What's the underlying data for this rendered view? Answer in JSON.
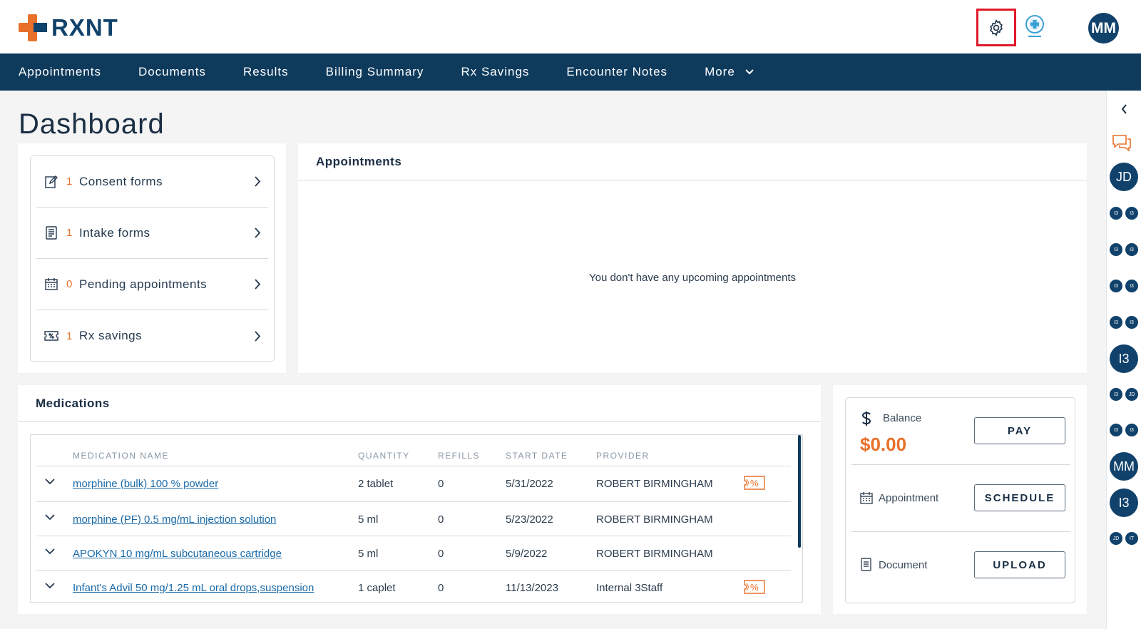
{
  "app": {
    "logo_text": "RXNT",
    "brand_colors": {
      "primary": "#0e3a5c",
      "accent": "#e8702a",
      "highlight": "#e0192a"
    },
    "user_initials": "MM"
  },
  "nav": {
    "items": [
      {
        "label": "Appointments"
      },
      {
        "label": "Documents"
      },
      {
        "label": "Results"
      },
      {
        "label": "Billing Summary"
      },
      {
        "label": "Rx Savings"
      },
      {
        "label": "Encounter Notes"
      },
      {
        "label": "More"
      }
    ]
  },
  "page": {
    "title": "Dashboard"
  },
  "quick_links": [
    {
      "icon": "consent-form-icon",
      "count": "1",
      "label": "Consent forms"
    },
    {
      "icon": "intake-form-icon",
      "count": "1",
      "label": "Intake forms"
    },
    {
      "icon": "calendar-icon",
      "count": "0",
      "label": "Pending appointments"
    },
    {
      "icon": "rx-savings-icon",
      "count": "1",
      "label": "Rx savings"
    }
  ],
  "appointments": {
    "title": "Appointments",
    "empty_message": "You don't have any upcoming appointments"
  },
  "medications": {
    "title": "Medications",
    "columns": [
      "MEDICATION NAME",
      "QUANTITY",
      "REFILLS",
      "START DATE",
      "PROVIDER"
    ],
    "rows": [
      {
        "name": "morphine (bulk) 100 % powder",
        "quantity": "2 tablet",
        "refills": "0",
        "start_date": "5/31/2022",
        "provider": "ROBERT BIRMINGHAM",
        "rx_savings": true
      },
      {
        "name": "morphine (PF) 0.5 mg/mL injection solution",
        "quantity": "5 ml",
        "refills": "0",
        "start_date": "5/23/2022",
        "provider": "ROBERT BIRMINGHAM",
        "rx_savings": false
      },
      {
        "name": "APOKYN 10 mg/mL subcutaneous cartridge",
        "quantity": "5 ml",
        "refills": "0",
        "start_date": "5/9/2022",
        "provider": "ROBERT BIRMINGHAM",
        "rx_savings": false
      },
      {
        "name": "Infant's Advil 50 mg/1.25 mL oral drops,suspension",
        "quantity": "1 caplet",
        "refills": "0",
        "start_date": "11/13/2023",
        "provider": "Internal 3Staff",
        "rx_savings": true
      }
    ]
  },
  "billing": {
    "balance_label": "Balance",
    "balance_amount": "$0.00",
    "pay_button": "PAY",
    "appointment_label": "Appointment",
    "schedule_button": "SCHEDULE",
    "document_label": "Document",
    "upload_button": "UPLOAD"
  },
  "rail": {
    "items": [
      {
        "type": "collapse",
        "icon": "chevron-left-icon"
      },
      {
        "type": "chat",
        "icon": "chat-bubbles-icon"
      },
      {
        "type": "avatar",
        "text": "JD"
      },
      {
        "type": "pair",
        "a": "I3",
        "b": "I3"
      },
      {
        "type": "pair",
        "a": "I3",
        "b": "I3"
      },
      {
        "type": "pair",
        "a": "I3",
        "b": "I3"
      },
      {
        "type": "pair",
        "a": "I3",
        "b": "I3"
      },
      {
        "type": "avatar",
        "text": "I3"
      },
      {
        "type": "pair",
        "a": "I3",
        "b": "JD"
      },
      {
        "type": "pair",
        "a": "I3",
        "b": "I3"
      },
      {
        "type": "avatar",
        "text": "MM"
      },
      {
        "type": "avatar",
        "text": "I3"
      },
      {
        "type": "pair",
        "a": "JD",
        "b": "IT"
      }
    ]
  }
}
